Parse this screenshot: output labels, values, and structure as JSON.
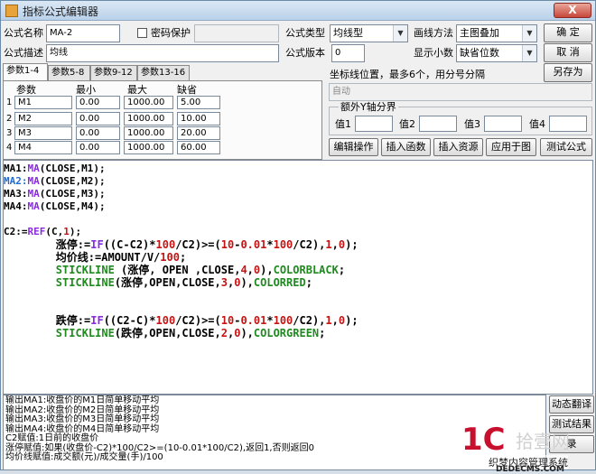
{
  "window": {
    "title": "指标公式编辑器",
    "close_label": "X"
  },
  "form": {
    "name_label": "公式名称",
    "name_value": "MA-2",
    "password_label": "密码保护",
    "password_checked": false,
    "desc_label": "公式描述",
    "desc_value": "均线",
    "type_label": "公式类型",
    "type_value": "均线型",
    "draw_label": "画线方法",
    "draw_value": "主图叠加",
    "version_label": "公式版本",
    "version_value": "0",
    "decimal_label": "显示小数",
    "decimal_value": "缺省位数",
    "ok_label": "确    定",
    "cancel_label": "取    消",
    "saveas_label": "另存为"
  },
  "tabs": [
    "参数1-4",
    "参数5-8",
    "参数9-12",
    "参数13-16"
  ],
  "params": {
    "headers": [
      "参数",
      "最小",
      "最大",
      "缺省"
    ],
    "rows": [
      {
        "num": "1",
        "name": "M1",
        "min": "0.00",
        "max": "1000.00",
        "def": "5.00"
      },
      {
        "num": "2",
        "name": "M2",
        "min": "0.00",
        "max": "1000.00",
        "def": "10.00"
      },
      {
        "num": "3",
        "name": "M3",
        "min": "0.00",
        "max": "1000.00",
        "def": "20.00"
      },
      {
        "num": "4",
        "name": "M4",
        "min": "0.00",
        "max": "1000.00",
        "def": "60.00"
      }
    ]
  },
  "coords": {
    "label": "坐标线位置，最多6个，用分号分隔",
    "value": "自动"
  },
  "extra_y": {
    "label": "额外Y轴分界",
    "v1": "值1",
    "v2": "值2",
    "v3": "值3",
    "v4": "值4"
  },
  "actions": {
    "edit": "编辑操作",
    "insert_func": "插入函数",
    "insert_res": "插入资源",
    "apply": "应用于图",
    "test": "测试公式"
  },
  "side_buttons": {
    "translate": "动态翻译",
    "test_result": "测试结果",
    "record": "录"
  },
  "code": {
    "l1a": "MA1:",
    "l1b": "MA",
    "l1c": "(CLOSE,M1);",
    "l2a": "MA2:",
    "l2b": "MA",
    "l2c": "(CLOSE,M2);",
    "l3a": "MA3:",
    "l3b": "MA",
    "l3c": "(CLOSE,M3);",
    "l4a": "MA4:",
    "l4b": "MA",
    "l4c": "(CLOSE,M4);",
    "l5a": "C2:=",
    "l5b": "REF",
    "l5c": "(C,",
    "l5d": "1",
    "l5e": ");",
    "l6a": "        涨停:=",
    "l6b": "IF",
    "l6c": "((C-C2)*",
    "l6d": "100",
    "l6e": "/C2)>=(",
    "l6f": "10",
    "l6g": "-",
    "l6h": "0.01",
    "l6i": "*",
    "l6j": "100",
    "l6k": "/C2),",
    "l6l": "1",
    "l6m": ",",
    "l6n": "0",
    "l6o": ");",
    "l7a": "        均价线:=AMOUNT/V/",
    "l7b": "100",
    "l7c": ";",
    "l8a": "        STICKLINE",
    "l8b": " (涨停, OPEN ,CLOSE,",
    "l8c": "4",
    "l8d": ",",
    "l8e": "0",
    "l8f": "),",
    "l8g": "COLORBLACK",
    "l8h": ";",
    "l9a": "        STICKLINE",
    "l9b": "(涨停,OPEN,CLOSE,",
    "l9c": "3",
    "l9d": ",",
    "l9e": "0",
    "l9f": "),",
    "l9g": "COLORRED",
    "l9h": ";",
    "l10a": "        跌停:=",
    "l10b": "IF",
    "l10c": "((C2-C)*",
    "l10d": "100",
    "l10e": "/C2)>=(",
    "l10f": "10",
    "l10g": "-",
    "l10h": "0.01",
    "l10i": "*",
    "l10j": "100",
    "l10k": "/C2),",
    "l10l": "1",
    "l10m": ",",
    "l10n": "0",
    "l10o": ");",
    "l11a": "        STICKLINE",
    "l11b": "(跌停,OPEN,CLOSE,",
    "l11c": "2",
    "l11d": ",",
    "l11e": "0",
    "l11f": "),",
    "l11g": "COLORGREEN",
    "l11h": ";"
  },
  "output": [
    "输出MA1:收盘价的M1日简单移动平均",
    "输出MA2:收盘价的M2日简单移动平均",
    "输出MA3:收盘价的M3日简单移动平均",
    "输出MA4:收盘价的M4日简单移动平均",
    "C2赋值:1日前的收盘价",
    "涨停赋值:如果(收盘价-C2)*100/C2>=(10-0.01*100/C2),返回1,否则返回0",
    "均价线赋值:成交额(元)/成交量(手)/100"
  ],
  "watermark": {
    "logo": "1C",
    "text": "拾壹网",
    "sub": "织梦内容管理系统",
    "url": "DEDECMS.COM"
  },
  "colors": {
    "keyword_blue": "#1f6ad3",
    "keyword_purple": "#8a2be2",
    "keyword_green": "#1f8a1f",
    "keyword_red": "#c41414"
  }
}
